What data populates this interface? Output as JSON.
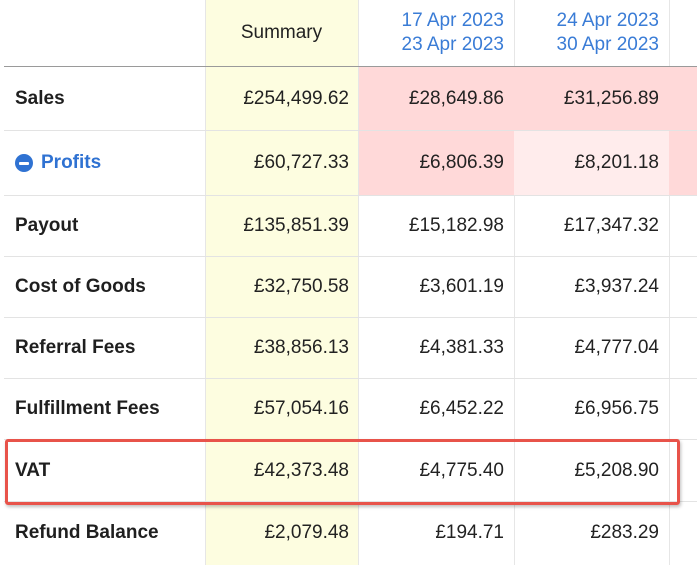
{
  "header": {
    "summary_label": "Summary",
    "periods": [
      {
        "start": "17 Apr 2023",
        "end": "23 Apr 2023"
      },
      {
        "start": "24 Apr 2023",
        "end": "30 Apr 2023"
      }
    ]
  },
  "rows": [
    {
      "label": "Sales",
      "summary": "£254,499.62",
      "p1": "£28,649.86",
      "p2": "£31,256.89"
    },
    {
      "label": "Profits",
      "summary": "£60,727.33",
      "p1": "£6,806.39",
      "p2": "£8,201.18"
    },
    {
      "label": "Payout",
      "summary": "£135,851.39",
      "p1": "£15,182.98",
      "p2": "£17,347.32"
    },
    {
      "label": "Cost of Goods",
      "summary": "£32,750.58",
      "p1": "£3,601.19",
      "p2": "£3,937.24"
    },
    {
      "label": "Referral Fees",
      "summary": "£38,856.13",
      "p1": "£4,381.33",
      "p2": "£4,777.04"
    },
    {
      "label": "Fulfillment Fees",
      "summary": "£57,054.16",
      "p1": "£6,452.22",
      "p2": "£6,956.75"
    },
    {
      "label": "VAT",
      "summary": "£42,373.48",
      "p1": "£4,775.40",
      "p2": "£5,208.90"
    },
    {
      "label": "Refund Balance",
      "summary": "£2,079.48",
      "p1": "£194.71",
      "p2": "£283.29"
    }
  ],
  "colors": {
    "link_blue": "#2f72d2",
    "summary_bg": "#fdfde0",
    "negative_bg": "#ffd9d9",
    "negative_light_bg": "#ffecec",
    "highlight_border": "#e8534a"
  },
  "icons": {
    "profits_toggle": "minus-circle-icon"
  }
}
